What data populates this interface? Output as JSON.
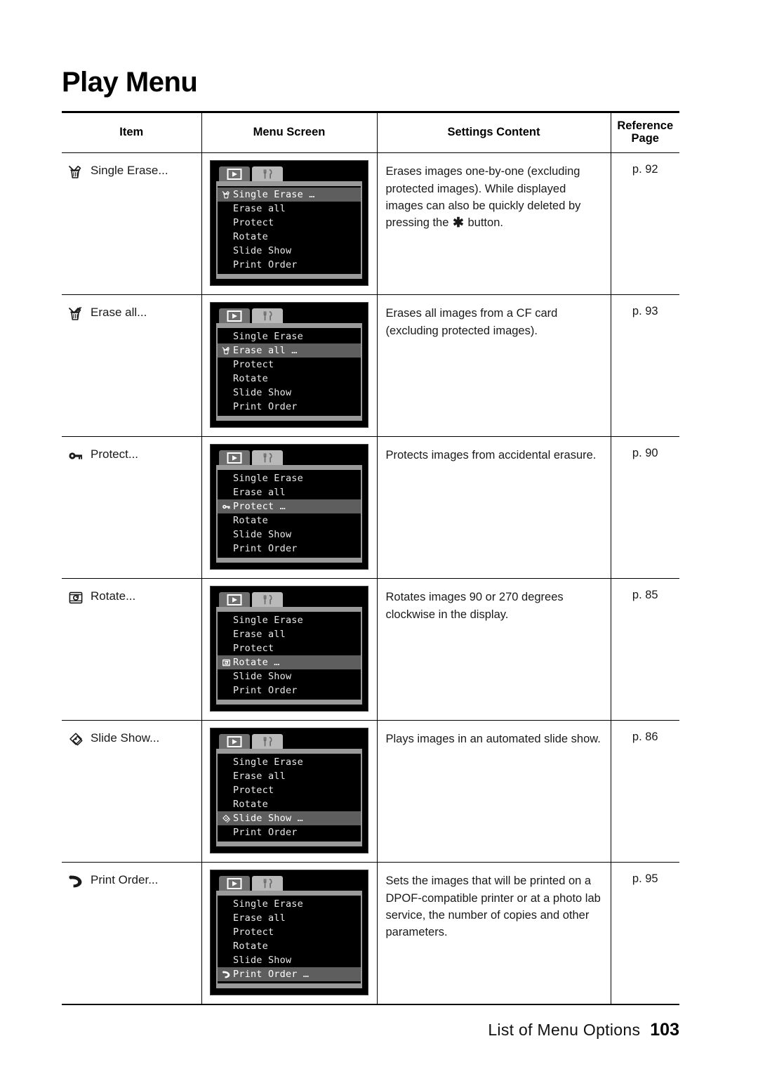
{
  "document": {
    "title": "Play Menu",
    "footer_label": "List of Menu Options",
    "footer_page_number": "103"
  },
  "table": {
    "headers": {
      "item": "Item",
      "menu_screen": "Menu Screen",
      "settings_content": "Settings Content",
      "reference_page_line1": "Reference",
      "reference_page_line2": "Page"
    },
    "rows": [
      {
        "icon": "single-erase-icon",
        "item_label": "Single Erase...",
        "description_before_star": "Erases images one-by-one (excluding protected images). While displayed images can also be quickly deleted by pressing the ",
        "star_symbol": "✱",
        "description_after_star": " button.",
        "reference_page": "p. 92",
        "selected_index": 0
      },
      {
        "icon": "erase-all-icon",
        "item_label": "Erase all...",
        "description": "Erases all images from a CF card (excluding protected images).",
        "reference_page": "p. 93",
        "selected_index": 1
      },
      {
        "icon": "protect-icon",
        "item_label": "Protect...",
        "description": "Protects images from accidental erasure.",
        "reference_page": "p. 90",
        "selected_index": 2
      },
      {
        "icon": "rotate-icon",
        "item_label": "Rotate...",
        "description": "Rotates images 90 or 270 degrees clockwise in the display.",
        "reference_page": "p. 85",
        "selected_index": 3
      },
      {
        "icon": "slide-show-icon",
        "item_label": "Slide Show...",
        "description": "Plays images in an automated slide show.",
        "reference_page": "p. 86",
        "selected_index": 4
      },
      {
        "icon": "print-order-icon",
        "item_label": "Print Order...",
        "description": "Sets the images that will be printed on a DPOF-compatible printer or at a photo lab service, the number of copies and other parameters.",
        "reference_page": "p. 95",
        "selected_index": 5
      }
    ]
  },
  "lcd": {
    "tabs": [
      {
        "name": "playback-tab",
        "icon": "play-triangle-icon",
        "active": true
      },
      {
        "name": "setup-tab",
        "icon": "fork-knife-icon",
        "active": false
      }
    ],
    "menu_items": [
      {
        "label": "Single Erase",
        "label_selected": "Single Erase …",
        "icon": "single-erase-icon"
      },
      {
        "label": "Erase all",
        "label_selected": "Erase all …",
        "icon": "erase-all-icon"
      },
      {
        "label": "Protect",
        "label_selected": "Protect …",
        "icon": "protect-icon"
      },
      {
        "label": "Rotate",
        "label_selected": "Rotate …",
        "icon": "rotate-icon"
      },
      {
        "label": "Slide Show",
        "label_selected": "Slide Show …",
        "icon": "slide-show-icon"
      },
      {
        "label": "Print Order",
        "label_selected": "Print Order …",
        "icon": "print-order-icon"
      }
    ]
  },
  "colors": {
    "page_background": "#ffffff",
    "text": "#1a1a1a",
    "rule": "#000000",
    "lcd_background": "#000000",
    "lcd_chrome": "#9a9a9a",
    "lcd_selection": "#5e5e5e",
    "lcd_tab_active": "#6e6e6e",
    "lcd_tab_inactive": "#b9b9b9"
  }
}
